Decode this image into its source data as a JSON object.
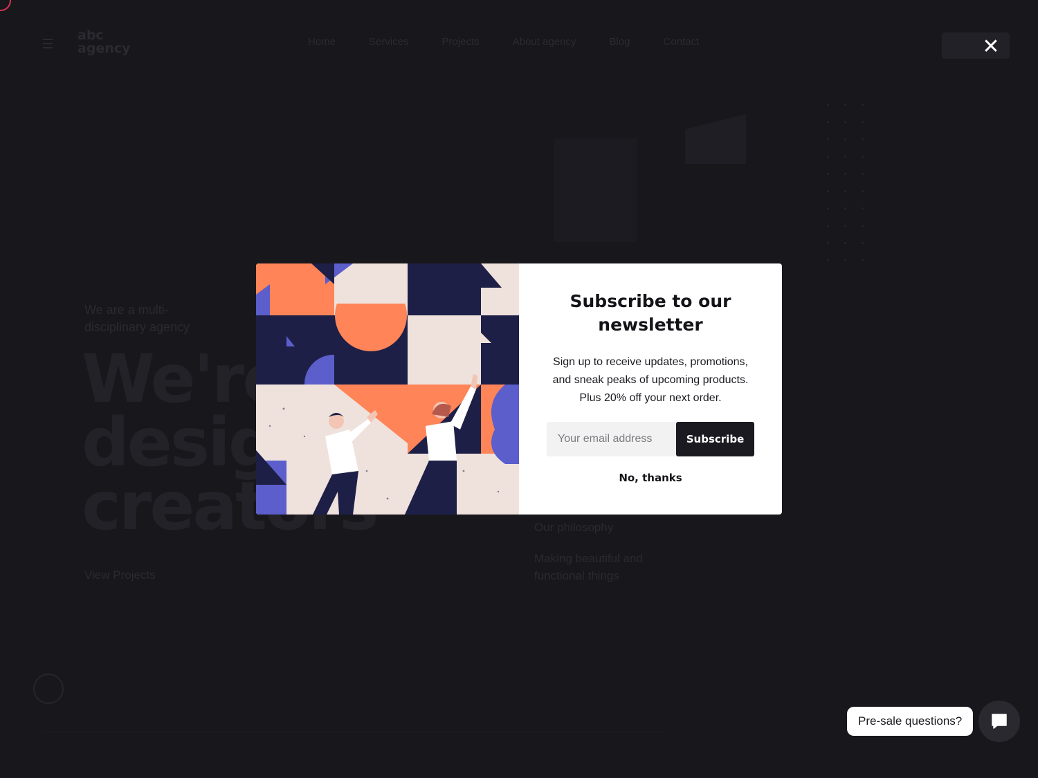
{
  "background": {
    "logo": "abc\nagency",
    "nav_items": [
      "Home",
      "Services",
      "Projects",
      "About agency",
      "Blog",
      "Contact"
    ],
    "cart_label": "",
    "kicker": "We are a multi-\ndisciplinary agency",
    "hero_title": "We're\ndesign\ncreators",
    "hero_link": "View Projects",
    "right_title": "Our philosophy",
    "right_desc": "Making beautiful and\nfunctional things"
  },
  "modal": {
    "close_icon": "close-icon",
    "title": "Subscribe to our newsletter",
    "text": "Sign up to receive updates, promotions, and sneak peaks of upcoming products. Plus 20% off your next order.",
    "email_placeholder": "Your email address",
    "email_value": "",
    "subscribe_label": "Subscribe",
    "decline_label": "No, thanks"
  },
  "chat": {
    "bubble_text": "Pre-sale questions?",
    "icon": "chat-icon"
  },
  "colors": {
    "page_bg": "#18171c",
    "accent_orange": "#ff8458",
    "navy": "#1d1f46",
    "purple": "#5b5ecb",
    "cream": "#efe2dc"
  }
}
